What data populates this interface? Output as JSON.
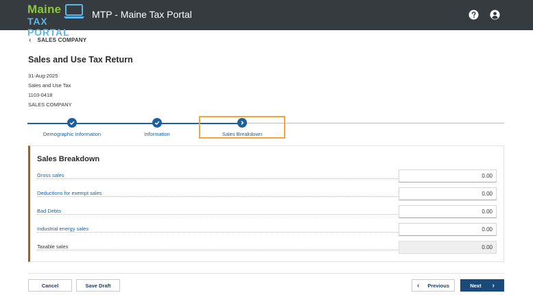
{
  "header": {
    "logo_line1": "Maine",
    "logo_line2": "TAX PORTAL",
    "app_title": "MTP - Maine Tax Portal",
    "icons": [
      "laptop-icon",
      "help-icon",
      "user-icon"
    ]
  },
  "breadcrumb": {
    "back_label": "SALES COMPANY"
  },
  "page": {
    "title": "Sales and Use Tax Return",
    "meta": [
      "31-Aug-2025",
      "Sales and Use Tax",
      "1103-0418",
      "SALES COMPANY"
    ]
  },
  "stepper": {
    "steps": [
      {
        "label": "Demographic Information",
        "status": "complete"
      },
      {
        "label": "Information",
        "status": "complete"
      },
      {
        "label": "Sales Breakdown",
        "status": "current"
      }
    ]
  },
  "section": {
    "title": "Sales Breakdown",
    "rows": [
      {
        "label": "Gross sales",
        "value": "0.00",
        "editable": true
      },
      {
        "label": "Deductions for exempt sales",
        "value": "0.00",
        "editable": true
      },
      {
        "label": "Bad Debts",
        "value": "0.00",
        "editable": true
      },
      {
        "label": "Industrial energy sales",
        "value": "0.00",
        "editable": true
      },
      {
        "label": "Taxable sales",
        "value": "0.00",
        "editable": false
      }
    ]
  },
  "footer": {
    "cancel_label": "Cancel",
    "save_draft_label": "Save Draft",
    "previous_label": "Previous",
    "next_label": "Next"
  },
  "colors": {
    "header_bg": "#363b40",
    "primary": "#1d5f9a",
    "highlight": "#f2a33a",
    "section_accent": "#b5521e"
  }
}
